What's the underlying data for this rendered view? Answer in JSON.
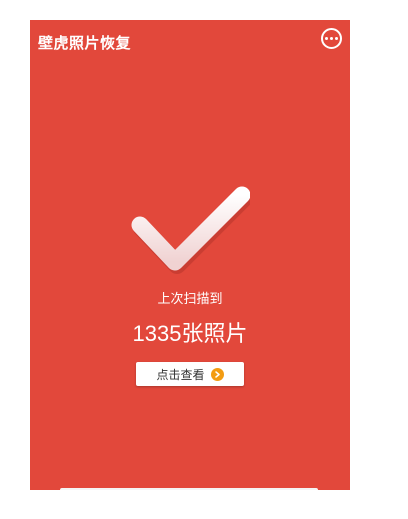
{
  "app": {
    "title": "壁虎照片恢复"
  },
  "result": {
    "scan_label": "上次扫描到",
    "photo_count": "1335张照片",
    "view_button_label": "点击查看"
  },
  "colors": {
    "background": "#e2483b",
    "button_arrow": "#f39c12"
  },
  "icons": {
    "more": "more-options-icon",
    "check": "checkmark-icon",
    "arrow": "arrow-right-icon"
  }
}
